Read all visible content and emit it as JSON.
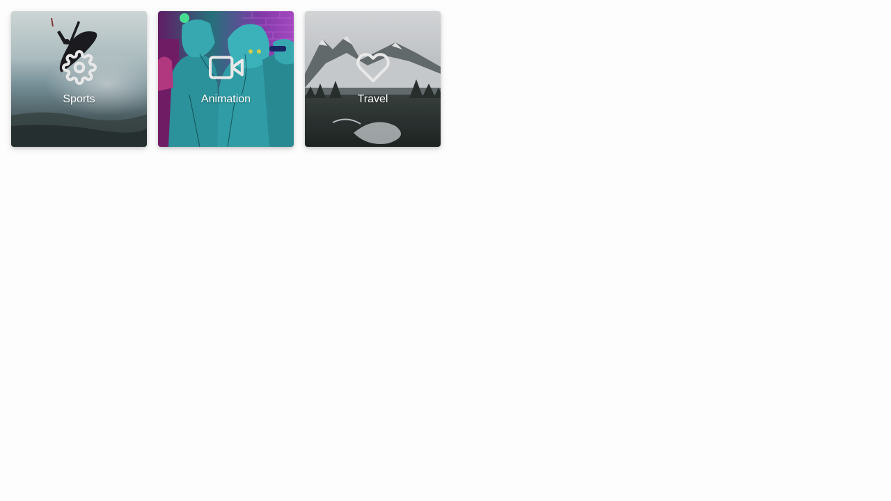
{
  "categories": [
    {
      "label": "Sports",
      "icon": "gear-icon",
      "image": "surfer-wave-photo"
    },
    {
      "label": "Animation",
      "icon": "video-camera-icon",
      "image": "cartoon-characters-illustration"
    },
    {
      "label": "Travel",
      "icon": "heart-icon",
      "image": "snowy-mountains-forest-photo"
    }
  ],
  "colors": {
    "page_background": "#fdfdfd",
    "label_text": "#ffffff",
    "icon_stroke": "#e8e8e8"
  }
}
